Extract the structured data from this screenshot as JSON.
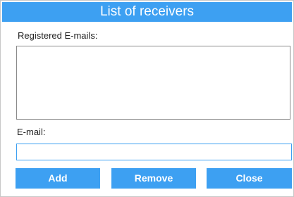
{
  "dialog": {
    "title": "List of receivers"
  },
  "registered": {
    "label": "Registered E-mails:",
    "items": []
  },
  "email": {
    "label": "E-mail:",
    "value": "",
    "placeholder": ""
  },
  "buttons": {
    "add": "Add",
    "remove": "Remove",
    "close": "Close"
  },
  "colors": {
    "accent": "#3da0f2",
    "text": "#222222",
    "border": "#8a8a8a"
  }
}
